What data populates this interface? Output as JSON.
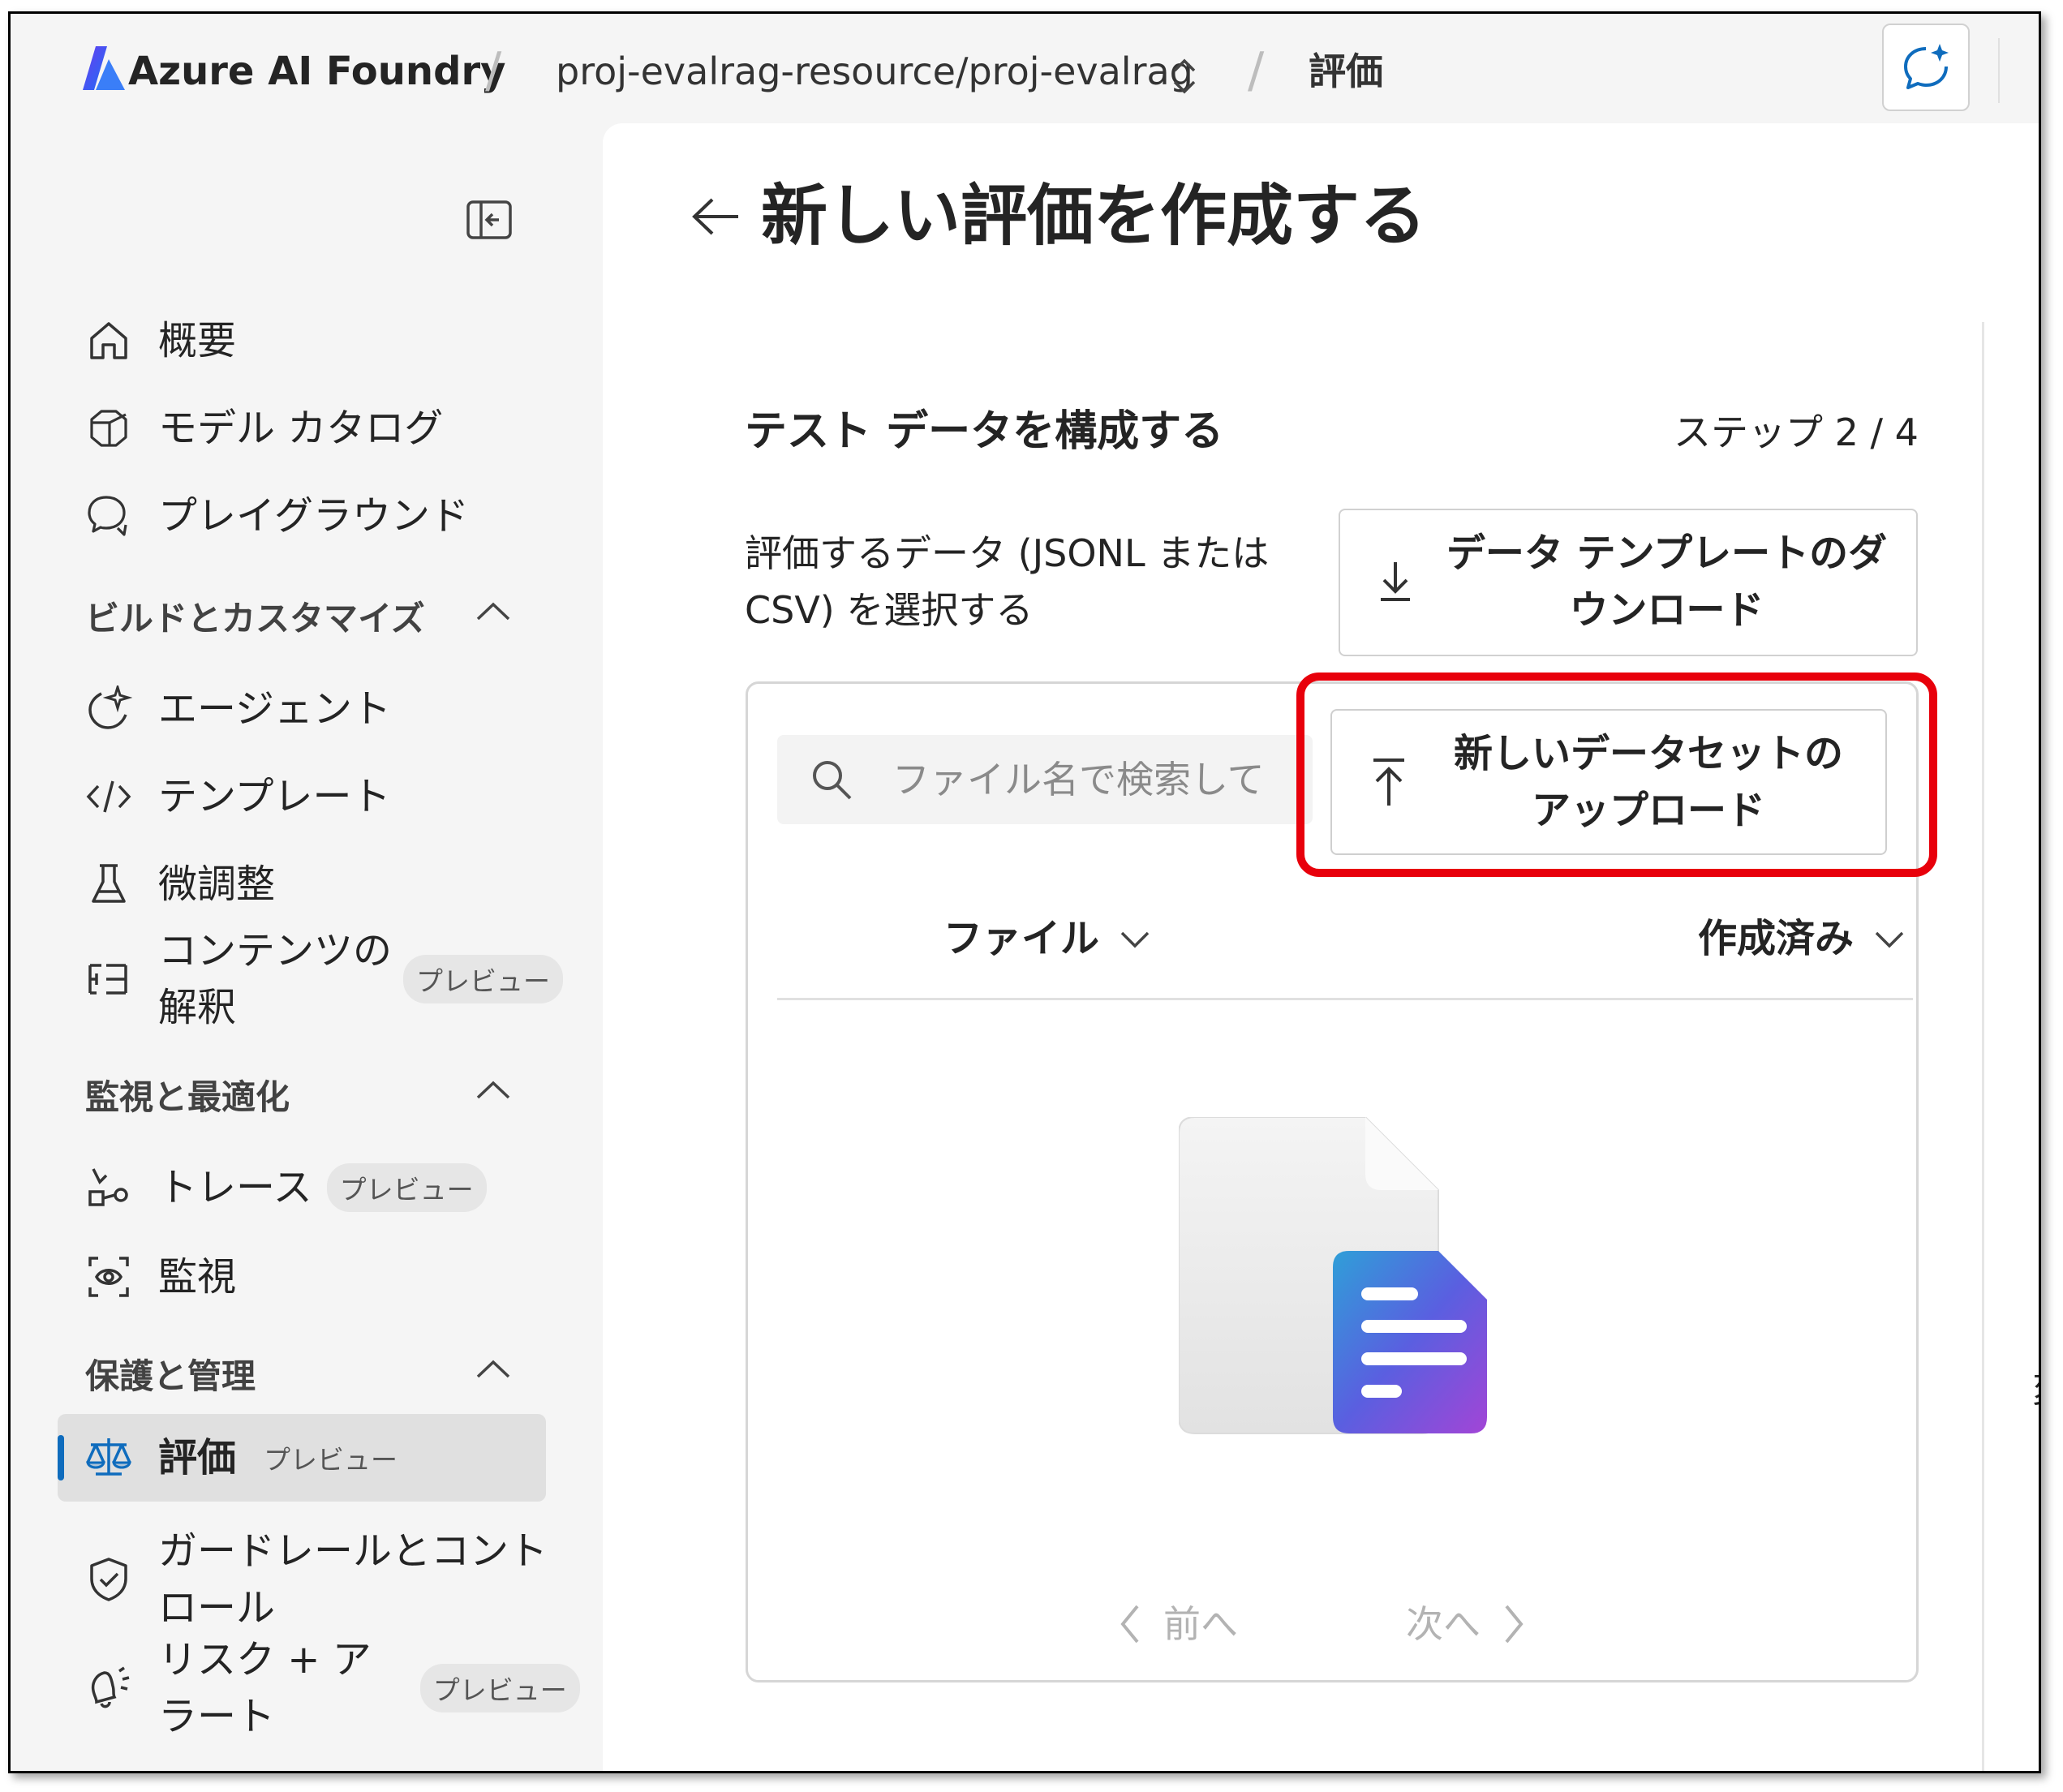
{
  "topbar": {
    "brand": "Azure AI Foundry",
    "project": "proj-evalrag-resource/proj-evalrag",
    "current": "評価",
    "separator": "/"
  },
  "sidebar": {
    "items_top": [
      {
        "label": "概要",
        "icon": "home-icon"
      },
      {
        "label": "モデル カタログ",
        "icon": "cube-icon"
      },
      {
        "label": "プレイグラウンド",
        "icon": "chat-icon"
      }
    ],
    "section_build": "ビルドとカスタマイズ",
    "items_build": [
      {
        "label": "エージェント",
        "icon": "agent-sparkle-icon"
      },
      {
        "label": "テンプレート",
        "icon": "code-icon"
      },
      {
        "label": "微調整",
        "icon": "flask-icon"
      },
      {
        "label_line1": "コンテンツの",
        "label_line2": "解釈",
        "badge": "プレビュー",
        "icon": "list-tree-icon"
      }
    ],
    "section_monitor": "監視と最適化",
    "items_monitor": [
      {
        "label": "トレース",
        "badge": "プレビュー",
        "icon": "trace-icon"
      },
      {
        "label": "監視",
        "icon": "monitor-icon"
      }
    ],
    "section_protect": "保護と管理",
    "items_protect": [
      {
        "label": "評価",
        "badge": "プレビュー",
        "icon": "scale-icon",
        "active": true
      },
      {
        "label_line1": "ガードレールとコント",
        "label_line2": "ロール",
        "icon": "shield-icon"
      },
      {
        "label_line1": "リスク + ア",
        "label_line2": "ラート",
        "badge": "プレビュー",
        "icon": "alert-icon"
      }
    ]
  },
  "main": {
    "title": "新しい評価を作成する",
    "step_title": "テスト データを構成する",
    "step_count": "ステップ 2 / 4",
    "description": "評価するデータ (JSONL または CSV) を選択する",
    "download_button_line1": "データ テンプレートのダ",
    "download_button_line2": "ウンロード",
    "search_placeholder": "ファイル名で検索して",
    "upload_button_line1": "新しいデータセットの",
    "upload_button_line2": "アップロード",
    "columns": {
      "file": "ファイル",
      "created": "作成済み"
    },
    "pager": {
      "prev": "前へ",
      "next": "次へ"
    }
  },
  "edge_text": "変",
  "colors": {
    "accent": "#0f6cbd",
    "highlight": "#e8000b",
    "sidebar_bg": "#f5f5f5"
  }
}
